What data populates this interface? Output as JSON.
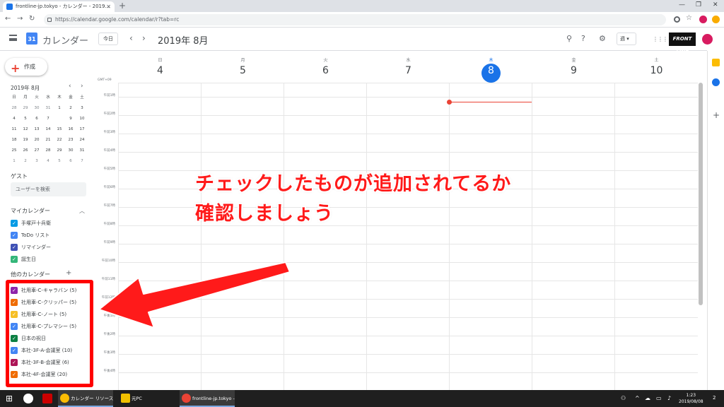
{
  "browser": {
    "tab_title": "frontline-jp.tokyo - カレンダー - 2019...",
    "url": "https://calendar.google.com/calendar/r?tab=rc"
  },
  "header": {
    "app_title": "カレンダー",
    "logo_number": "31",
    "today_label": "今日",
    "month_title": "2019年 8月",
    "view_label": "週",
    "brand": "FRONT LINE"
  },
  "sidebar": {
    "create_label": "作成",
    "mini_month": "2019年 8月",
    "weekdays": [
      "日",
      "月",
      "火",
      "水",
      "木",
      "金",
      "土"
    ],
    "weeks": [
      [
        "28",
        "29",
        "30",
        "31",
        "1",
        "2",
        "3"
      ],
      [
        "4",
        "5",
        "6",
        "7",
        "8",
        "9",
        "10"
      ],
      [
        "11",
        "12",
        "13",
        "14",
        "15",
        "16",
        "17"
      ],
      [
        "18",
        "19",
        "20",
        "21",
        "22",
        "23",
        "24"
      ],
      [
        "25",
        "26",
        "27",
        "28",
        "29",
        "30",
        "31"
      ],
      [
        "1",
        "2",
        "3",
        "4",
        "5",
        "6",
        "7"
      ]
    ],
    "guest_label": "ゲスト",
    "search_users_placeholder": "ユーザーを検索",
    "my_calendars_label": "マイカレンダー",
    "my_calendars": [
      {
        "label": "手塚戸十兵衛",
        "color": "#039be5"
      },
      {
        "label": "ToDo リスト",
        "color": "#4285f4"
      },
      {
        "label": "リマインダー",
        "color": "#3f51b5"
      },
      {
        "label": "誕生日",
        "color": "#33b679"
      }
    ],
    "other_calendars_label": "他のカレンダー",
    "other_calendars": [
      {
        "label": "社用車-C-キャラバン (5)",
        "color": "#8e24aa"
      },
      {
        "label": "社用車-C-クリッパー (5)",
        "color": "#ef6c00"
      },
      {
        "label": "社用車-C-ノート (5)",
        "color": "#f6bf26"
      },
      {
        "label": "社用車-C-プレマシー (5)",
        "color": "#4285f4"
      },
      {
        "label": "日本の祝日",
        "color": "#0b8043"
      },
      {
        "label": "本社-3F-A-会議室 (10)",
        "color": "#4285f4"
      },
      {
        "label": "本社-3F-B-会議室 (6)",
        "color": "#ad1457"
      },
      {
        "label": "本社-4F-会議室 (20)",
        "color": "#ef6c00"
      }
    ]
  },
  "week": {
    "timezone": "GMT+09",
    "days": [
      {
        "dow": "日",
        "num": "4"
      },
      {
        "dow": "月",
        "num": "5"
      },
      {
        "dow": "火",
        "num": "6"
      },
      {
        "dow": "水",
        "num": "7"
      },
      {
        "dow": "木",
        "num": "8"
      },
      {
        "dow": "金",
        "num": "9"
      },
      {
        "dow": "土",
        "num": "10"
      }
    ],
    "today_index": 4,
    "hours": [
      "午前1時",
      "午前2時",
      "午前3時",
      "午前4時",
      "午前5時",
      "午前6時",
      "午前7時",
      "午前8時",
      "午前9時",
      "午前10時",
      "午前11時",
      "午前12時",
      "午後1時",
      "午後2時",
      "午後3時",
      "午後4時",
      "午後5時"
    ]
  },
  "annotation": {
    "line1": "チェックしたものが追加されてるか",
    "line2": "確認しましょう"
  },
  "taskbar": {
    "items": [
      "カレンダー リソース - ...",
      "元PC",
      "frontline-jp.tokyo - ..."
    ],
    "time": "1:23",
    "date": "2019/08/08",
    "notification_count": "2"
  }
}
